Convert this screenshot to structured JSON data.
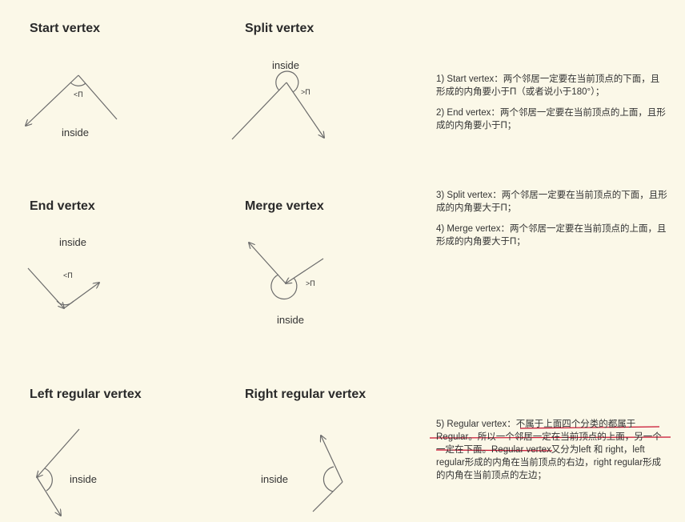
{
  "titles": {
    "start": "Start vertex",
    "split": "Split vertex",
    "end": "End vertex",
    "merge": "Merge vertex",
    "left_regular": "Left regular vertex",
    "right_regular": "Right regular vertex"
  },
  "labels": {
    "start_inside": "inside",
    "start_angle": "<Π",
    "split_inside": "inside",
    "split_angle": ">Π",
    "end_inside": "inside",
    "end_angle": "<Π",
    "merge_inside": "inside",
    "merge_angle": ">Π",
    "left_regular_inside": "inside",
    "right_regular_inside": "inside"
  },
  "notes": {
    "note1": "1) Start vertex：两个邻居一定要在当前顶点的下面，且形成的内角要小于Π（或者说小于180°）；",
    "note2": "2) End vertex：两个邻居一定要在当前顶点的上面，且形成的内角要小于Π；",
    "note3": "3) Split vertex：两个邻居一定要在当前顶点的下面，且形成的内角要大于Π；",
    "note4": "4) Merge vertex：两个邻居一定要在当前顶点的上面，且形成的内角要大于Π；",
    "note5": "5) Regular vertex：不属于上面四个分类的都属于Regular。所以一个邻居一定在当前顶点的上面，另一个一定在下面。Regular vertex又分为left 和 right，left regular形成的内角在当前顶点的右边，right regular形成的内角在当前顶点的左边；"
  },
  "colors": {
    "background": "#fbf8e8",
    "line": "#6b6b6b",
    "annotation_underline": "#c8102e"
  }
}
